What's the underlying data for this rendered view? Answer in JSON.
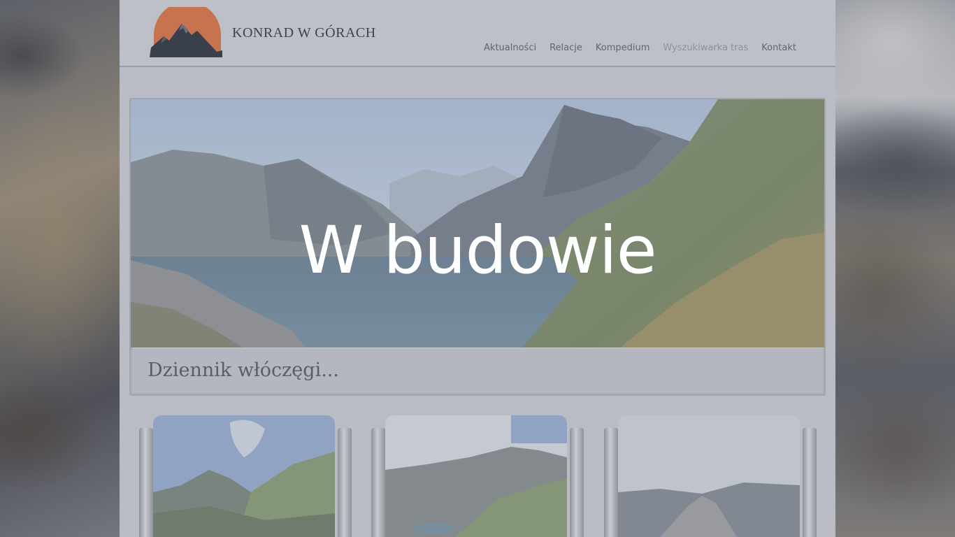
{
  "site": {
    "title": "KONRAD W GÓRACH"
  },
  "nav": {
    "items": [
      {
        "label": "Aktualności",
        "active": false
      },
      {
        "label": "Relacje",
        "active": false
      },
      {
        "label": "Kompedium",
        "active": false
      },
      {
        "label": "Wyszukiwarka tras",
        "active": true
      },
      {
        "label": "Kontakt",
        "active": false
      }
    ]
  },
  "hero": {
    "heading": "W budowie",
    "subtitle": "Dziennik włóczęgi..."
  },
  "colors": {
    "logo_sun": "#c8734f",
    "logo_mountain": "#3a3f4c",
    "overlay": "#b9bcc4",
    "heading_text": "#ffffff"
  },
  "cards": [
    {
      "icon": "mountain-photo"
    },
    {
      "icon": "mountain-photo"
    },
    {
      "icon": "mountain-photo"
    }
  ]
}
